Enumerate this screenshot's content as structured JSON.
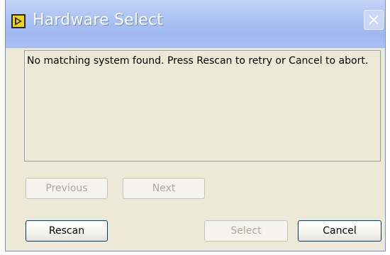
{
  "window": {
    "title": "Hardware Select",
    "app_icon": "labview-run-icon",
    "close_icon": "close-icon"
  },
  "message": {
    "text": "No matching system found. Press Rescan to retry or Cancel to abort."
  },
  "navigation": {
    "previous_label": "Previous",
    "next_label": "Next"
  },
  "actions": {
    "rescan_label": "Rescan",
    "select_label": "Select",
    "cancel_label": "Cancel"
  },
  "colors": {
    "titlebar": "#aec4f3",
    "window_bg": "#ece9d8",
    "disabled_text": "#aca899",
    "button_border": "#003c74"
  }
}
